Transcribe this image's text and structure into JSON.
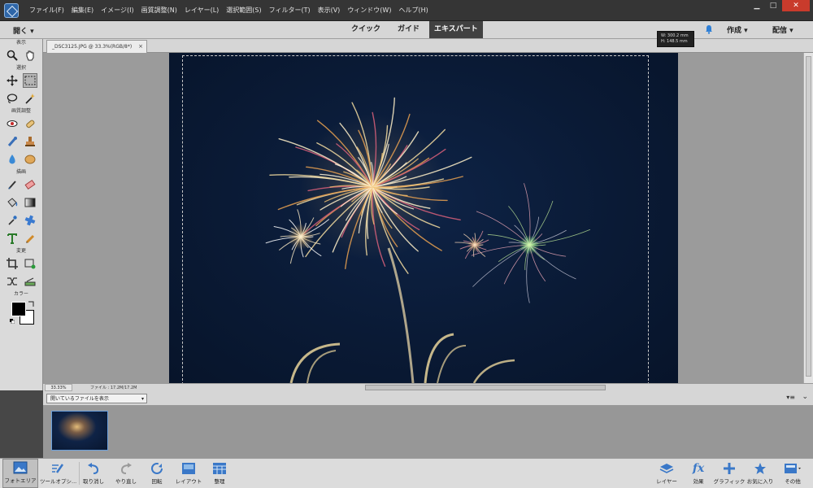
{
  "menu": [
    "ファイル(F)",
    "編集(E)",
    "イメージ(I)",
    "画質調整(N)",
    "レイヤー(L)",
    "選択範囲(S)",
    "フィルター(T)",
    "表示(V)",
    "ウィンドウ(W)",
    "ヘルプ(H)"
  ],
  "window_controls": {
    "min": "▁",
    "max": "□",
    "close": "✕"
  },
  "modebar": {
    "open_label": "開く",
    "modes": [
      "クイック",
      "ガイド",
      "エキスパート"
    ],
    "active_mode": "エキスパート",
    "create_label": "作成",
    "share_label": "配信"
  },
  "dimension_tooltip": {
    "w": "W: 300.2 mm",
    "h": "H: 148.5 mm"
  },
  "toolbox": {
    "sections": {
      "view": "表示",
      "select": "選択",
      "enhance": "画質調整",
      "draw": "描画",
      "modify": "変更",
      "color": "カラー"
    }
  },
  "document": {
    "tab_title": "_DSC3125.JPG @ 33.3%(RGB/8*)",
    "close": "×"
  },
  "status": {
    "zoom": "33.33%",
    "file_info": "ファイル : 17.2M/17.2M"
  },
  "bin": {
    "selector": "開いているファイルを表示"
  },
  "taskbar": {
    "photo_area": "フォトエリア",
    "tool_options": "ツールオプシ...",
    "undo": "取り消し",
    "redo": "やり直し",
    "rotate": "回転",
    "layout": "レイアウト",
    "organize": "整理",
    "layers": "レイヤー",
    "effects": "効果",
    "graphics": "グラフィック",
    "favorites": "お気に入り",
    "more": "その他"
  },
  "colors": {
    "accent": "#2e66a8",
    "fg_color": "#000000",
    "bg_color": "#ffffff"
  }
}
